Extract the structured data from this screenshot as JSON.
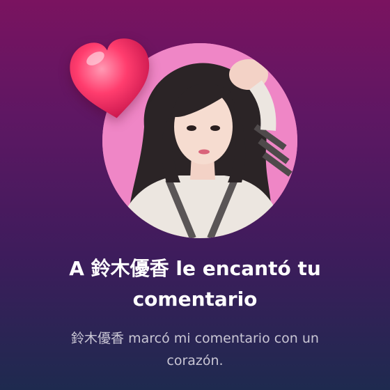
{
  "notification": {
    "user_name": "鈴木優香",
    "title_prefix": "A ",
    "title_suffix": " le encantó tu comentario",
    "subtitle_suffix": " marcó mi comentario con un corazón.",
    "reaction_icon": "heart-icon",
    "avatar_icon": "profile-photo"
  },
  "colors": {
    "heart": "#ff3d6e",
    "avatar_bg": "#f07bc0",
    "title_text": "#ffffff",
    "subtitle_text": "#c9c6d4"
  }
}
